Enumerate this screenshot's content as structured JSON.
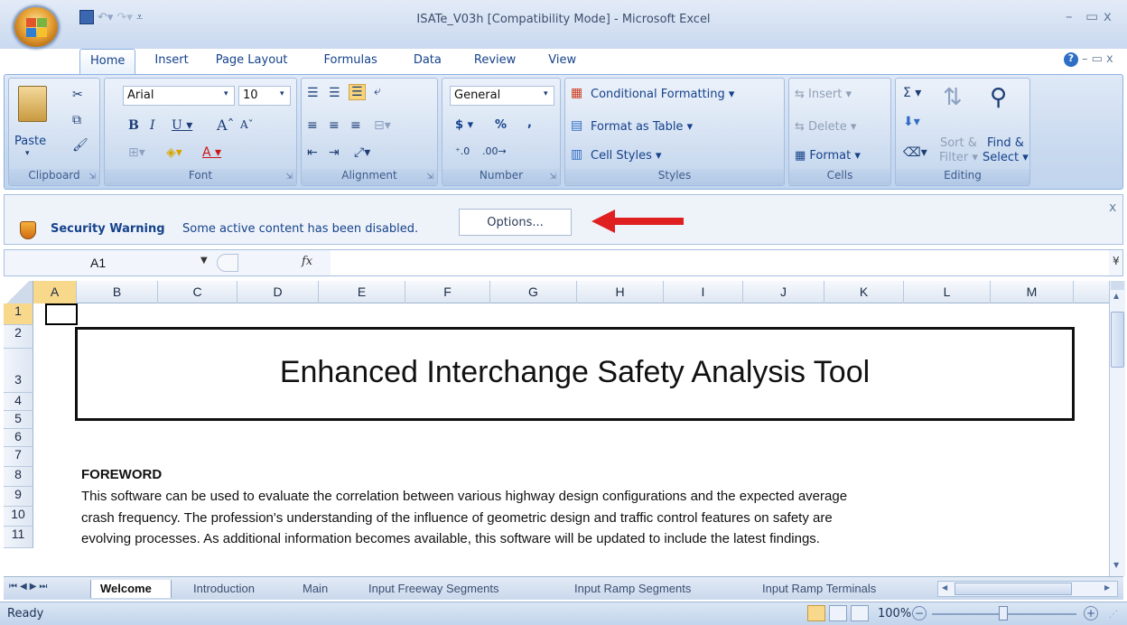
{
  "window": {
    "title": "ISATe_V03h  [Compatibility Mode] - Microsoft Excel"
  },
  "tabs": [
    "Home",
    "Insert",
    "Page Layout",
    "Formulas",
    "Data",
    "Review",
    "View"
  ],
  "ribbon": {
    "clipboard": {
      "paste": "Paste",
      "label": "Clipboard"
    },
    "font": {
      "name": "Arial",
      "size": "10",
      "label": "Font"
    },
    "alignment": {
      "label": "Alignment"
    },
    "number": {
      "format": "General",
      "currency": "$",
      "percent": "%",
      "comma": ",",
      "label": "Number"
    },
    "styles": {
      "conditional": "Conditional Formatting",
      "table": "Format as Table",
      "cell": "Cell Styles",
      "label": "Styles"
    },
    "cells": {
      "insert": "Insert",
      "delete": "Delete",
      "format": "Format",
      "label": "Cells"
    },
    "editing": {
      "sort1": "Sort &",
      "sort2": "Filter",
      "find1": "Find &",
      "find2": "Select",
      "label": "Editing"
    }
  },
  "security": {
    "title": "Security Warning",
    "message": "Some active content has been disabled.",
    "options": "Options..."
  },
  "formula": {
    "cell": "A1",
    "fx": "fx",
    "value": ""
  },
  "columns": [
    "A",
    "B",
    "C",
    "D",
    "E",
    "F",
    "G",
    "H",
    "I",
    "J",
    "K",
    "L",
    "M"
  ],
  "rows": [
    "1",
    "2",
    "3",
    "4",
    "5",
    "6",
    "7",
    "8",
    "9",
    "10",
    "11"
  ],
  "sheet": {
    "heading": "Enhanced Interchange Safety Analysis Tool",
    "foreword_title": "FOREWORD",
    "lines": [
      "This software can be used to evaluate the correlation between various highway design configurations and the expected average",
      "crash frequency.  The profession's understanding of the influence of geometric design and traffic control features on safety are",
      "evolving processes.  As additional information becomes available, this software will be updated to include the latest findings."
    ]
  },
  "sheet_tabs": [
    "Welcome",
    "Introduction",
    "Main",
    "Input Freeway Segments",
    "Input Ramp Segments",
    "Input Ramp Terminals"
  ],
  "status": {
    "ready": "Ready",
    "zoom": "100%"
  },
  "colors": {
    "accent": "#15428b",
    "arrow": "#e02020"
  }
}
